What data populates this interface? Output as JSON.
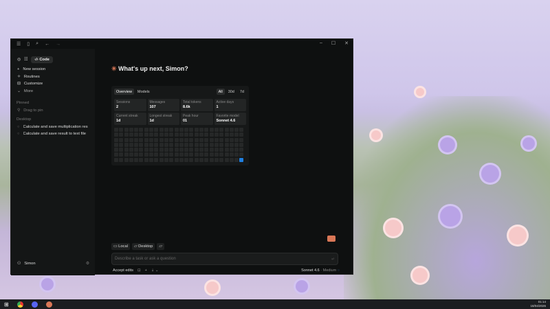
{
  "toolbar": {
    "mode_label": "Code"
  },
  "sidebar": {
    "items": [
      {
        "label": "New session",
        "icon": "plus"
      },
      {
        "label": "Routines",
        "icon": "routine"
      },
      {
        "label": "Customize",
        "icon": "briefcase"
      },
      {
        "label": "More",
        "icon": "chevron-down"
      }
    ],
    "pinned_header": "Pinned",
    "pinned_hint": "Drag to pin",
    "desktop_header": "Desktop",
    "sessions": [
      "Calculate and save multiplication res",
      "Calculate and save result to text file"
    ],
    "user": "Simon"
  },
  "main": {
    "greeting": "What's up next, Simon?",
    "tabs": [
      "Overview",
      "Models"
    ],
    "ranges": [
      "All",
      "30d",
      "7d"
    ],
    "stats": [
      {
        "label": "Sessions",
        "value": "2"
      },
      {
        "label": "Messages",
        "value": "107"
      },
      {
        "label": "Total tokens",
        "value": "8.6k"
      },
      {
        "label": "Active days",
        "value": "1"
      },
      {
        "label": "Current streak",
        "value": "1d"
      },
      {
        "label": "Longest streak",
        "value": "1d"
      },
      {
        "label": "Peak hour",
        "value": "01"
      },
      {
        "label": "Favorite model",
        "value": "Sonnet 4.6"
      }
    ],
    "heatmap_active_days": 1,
    "accent": "#1f7fe0"
  },
  "composer": {
    "chips": [
      "Local",
      "Desktop"
    ],
    "placeholder": "Describe a task or ask a question",
    "mode": "Accept edits",
    "model": "Sonnet 4.6",
    "effort": "· Medium"
  },
  "taskbar": {
    "time": "01:14",
    "date": "18/04/2026"
  }
}
